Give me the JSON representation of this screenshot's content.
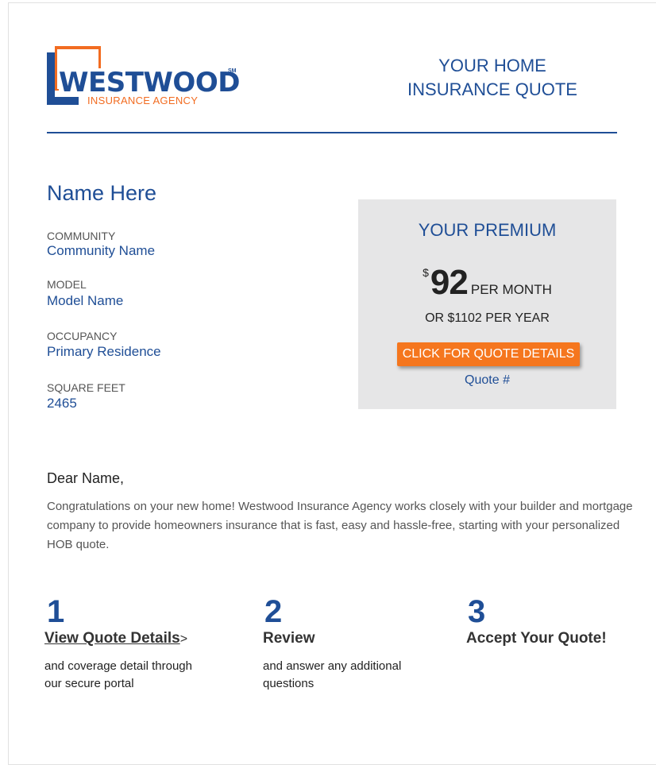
{
  "logo": {
    "word": "WESTWOOD",
    "sm": "SM",
    "sub": "INSURANCE AGENCY"
  },
  "header": {
    "title_line1": "YOUR HOME",
    "title_line2": "INSURANCE QUOTE"
  },
  "customer": {
    "name": "Name Here",
    "fields": [
      {
        "label": "COMMUNITY",
        "value": "Community Name"
      },
      {
        "label": "MODEL",
        "value": "Model Name"
      },
      {
        "label": "OCCUPANCY",
        "value": "Primary Residence"
      },
      {
        "label": "SQUARE FEET",
        "value": "2465"
      }
    ]
  },
  "premium": {
    "title": "YOUR PREMIUM",
    "currency": "$",
    "amount": "92",
    "per": "PER MONTH",
    "yearly": "OR $1102 PER YEAR",
    "button_label": "CLICK FOR QUOTE DETAILS",
    "quote_label": "Quote #"
  },
  "letter": {
    "greeting": "Dear Name,",
    "body": "Congratulations on your new home! Westwood Insurance Agency works closely with your builder and mortgage company to provide homeowners insurance that is fast, easy and hassle-free, starting with your personalized HOB quote."
  },
  "steps": [
    {
      "num": "1",
      "title": "View Quote Details",
      "arrow": ">",
      "desc_line1": "and coverage detail through",
      "desc_line2": "our secure portal"
    },
    {
      "num": "2",
      "title": "Review",
      "desc_line1": "and answer any additional",
      "desc_line2": "questions"
    },
    {
      "num": "3",
      "title": "Accept Your Quote!"
    }
  ],
  "colors": {
    "brand_blue": "#1f4e96",
    "brand_orange": "#f26c21",
    "premium_bg": "#e6e6e7"
  }
}
